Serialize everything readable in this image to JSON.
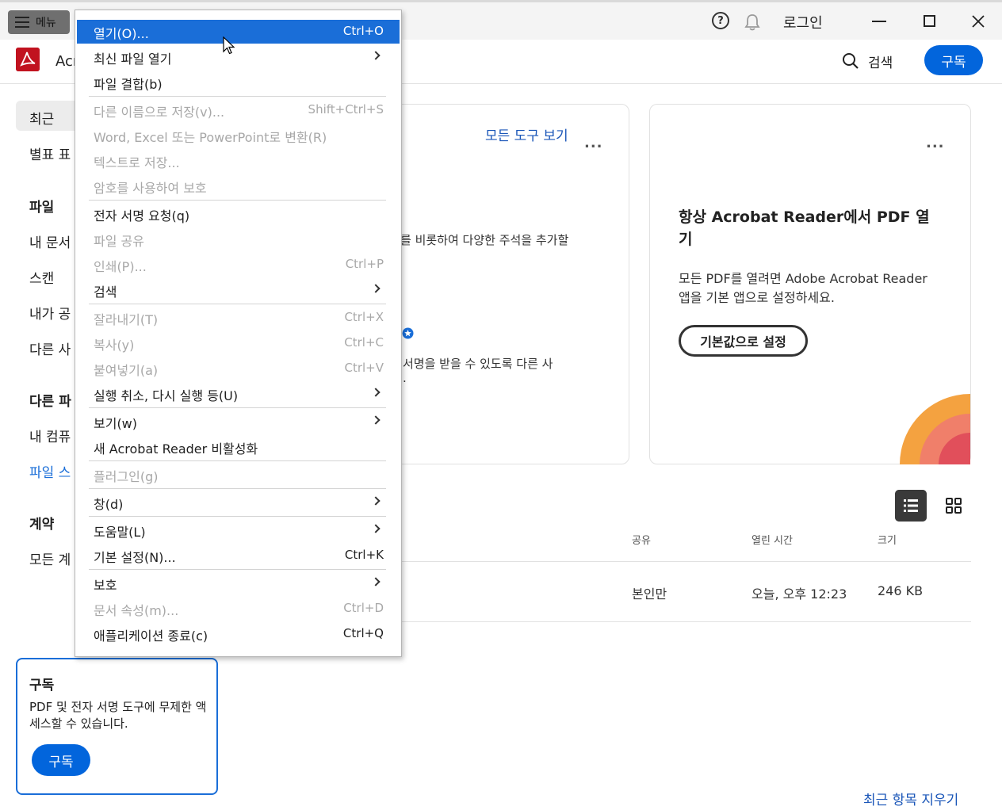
{
  "titlebar": {
    "menu_label": "메뉴",
    "help_symbol": "?",
    "login_label": "로그인"
  },
  "header": {
    "app_name_visible": "Acr",
    "search_label": "검색",
    "subscribe_label": "구독"
  },
  "sidebar": {
    "recent": "최근",
    "starred": "별표 표",
    "files_heading": "파일",
    "my_docs": "내 문서",
    "scans": "스캔",
    "shared_by_me": "내가 공",
    "shared_by_others": "다른 사",
    "other_files_heading": "다른 파",
    "my_computer": "내 컴퓨",
    "file_storage": "파일 스",
    "agreements_heading": "계약",
    "all_agreements": "모든 계"
  },
  "card1": {
    "all_tools_link": "모든 도구 보기",
    "dots": "...",
    "line1": "를 비롯하여 다양한 주석을 추가할",
    "line2": "서명을 받을 수 있도록 다른 사",
    "line3": "."
  },
  "card2": {
    "dots": "...",
    "title": "항상 Acrobat Reader에서 PDF 열기",
    "body": "모든 PDF를 열려면 Adobe Acrobat Reader 앱을 기본 앱으로 설정하세요.",
    "button": "기본값으로 설정"
  },
  "table": {
    "headers": {
      "shared": "공유",
      "opened": "열린 시간",
      "size": "크기"
    },
    "rows": [
      {
        "shared": "본인만",
        "opened": "오늘, 오후 12:23",
        "size": "246 KB"
      }
    ]
  },
  "subscribe_card": {
    "title": "구독",
    "body": "PDF 및 전자 서명 도구에 무제한 액세스할 수 있습니다.",
    "button": "구독"
  },
  "clear_recent": "최근 항목 지우기",
  "colors": {
    "accent": "#0265dc",
    "brand_red": "#c1121f",
    "highlight": "#1a6ed8"
  },
  "menu": {
    "items": [
      {
        "label": "열기(O)...",
        "shortcut": "Ctrl+O",
        "enabled": true,
        "highlighted": true
      },
      {
        "label": "최신 파일 열기",
        "submenu": true,
        "enabled": true
      },
      {
        "label": "파일 결합(b)",
        "enabled": true
      },
      {
        "label": "다른 이름으로 저장(v)...",
        "shortcut": "Shift+Ctrl+S",
        "enabled": false
      },
      {
        "label": "Word, Excel 또는 PowerPoint로 변환(R)",
        "enabled": false
      },
      {
        "label": "텍스트로 저장...",
        "enabled": false
      },
      {
        "label": "암호를 사용하여 보호",
        "enabled": false
      },
      {
        "label": "전자 서명 요청(q)",
        "enabled": true
      },
      {
        "label": "파일 공유",
        "enabled": false
      },
      {
        "label": "인쇄(P)...",
        "shortcut": "Ctrl+P",
        "enabled": false
      },
      {
        "label": "검색",
        "submenu": true,
        "enabled": true
      },
      {
        "label": "잘라내기(T)",
        "shortcut": "Ctrl+X",
        "enabled": false
      },
      {
        "label": "복사(y)",
        "shortcut": "Ctrl+C",
        "enabled": false
      },
      {
        "label": "붙여넣기(a)",
        "shortcut": "Ctrl+V",
        "enabled": false
      },
      {
        "label": "실행 취소, 다시 실행 등(U)",
        "submenu": true,
        "enabled": true
      },
      {
        "label": "보기(w)",
        "submenu": true,
        "enabled": true
      },
      {
        "label": "새 Acrobat Reader 비활성화",
        "enabled": true
      },
      {
        "label": "플러그인(g)",
        "enabled": false
      },
      {
        "label": "창(d)",
        "submenu": true,
        "enabled": true
      },
      {
        "label": "도움말(L)",
        "submenu": true,
        "enabled": true
      },
      {
        "label": "기본 설정(N)...",
        "shortcut": "Ctrl+K",
        "enabled": true
      },
      {
        "label": "보호",
        "submenu": true,
        "enabled": true
      },
      {
        "label": "문서 속성(m)...",
        "shortcut": "Ctrl+D",
        "enabled": false
      },
      {
        "label": "애플리케이션 종료(c)",
        "shortcut": "Ctrl+Q",
        "enabled": true
      }
    ]
  }
}
